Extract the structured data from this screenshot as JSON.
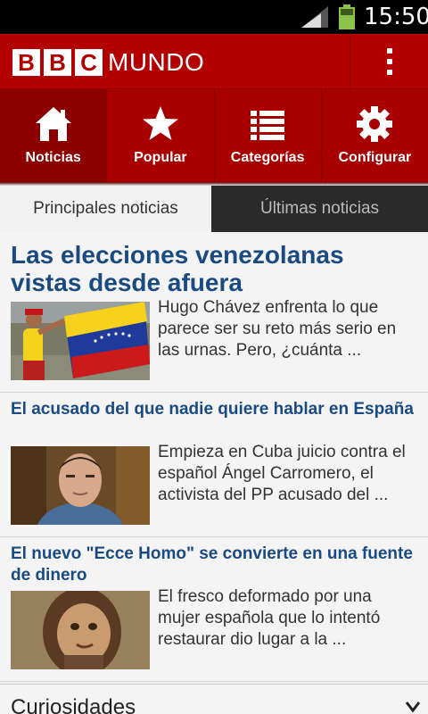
{
  "status_bar": {
    "time": "15:50",
    "icons": [
      "signal-icon",
      "battery-icon"
    ]
  },
  "app_bar": {
    "logo_letters": [
      "B",
      "B",
      "C"
    ],
    "logo_word": "MUNDO",
    "overflow_icon": "more-vertical-icon"
  },
  "nav": {
    "items": [
      {
        "label": "Noticias",
        "icon": "home-icon",
        "active": true
      },
      {
        "label": "Popular",
        "icon": "star-icon",
        "active": false
      },
      {
        "label": "Categorías",
        "icon": "list-icon",
        "active": false
      },
      {
        "label": "Configurar",
        "icon": "gear-icon",
        "active": false
      }
    ]
  },
  "tabs": [
    {
      "label": "Principales noticias",
      "active": true
    },
    {
      "label": "Últimas noticias",
      "active": false
    }
  ],
  "stories": [
    {
      "headline": "Las elecciones venezolanas vistas desde afuera",
      "summary": "Hugo Chávez enfrenta lo que parece ser su reto más serio en las urnas. Pero, ¿cuánta ...",
      "image": "venezuela-flag-photo"
    },
    {
      "headline": "El acusado del que nadie quiere hablar en España",
      "summary": "Empieza en Cuba juicio contra el español Ángel Carromero, el activista del PP acusado del ...",
      "image": "man-portrait-photo"
    },
    {
      "headline": "El nuevo \"Ecce Homo\" se convierte en una fuente de dinero",
      "summary": "El fresco deformado por una mujer española que lo intentó restaurar dio lugar a la ...",
      "image": "ecce-homo-fresco-photo"
    }
  ],
  "section": {
    "title": "Curiosidades",
    "chevron_icon": "chevron-down-icon"
  },
  "colors": {
    "brand_red": "#b30000",
    "headline_blue": "#1a4a80",
    "battery_green": "#8bc34a"
  }
}
